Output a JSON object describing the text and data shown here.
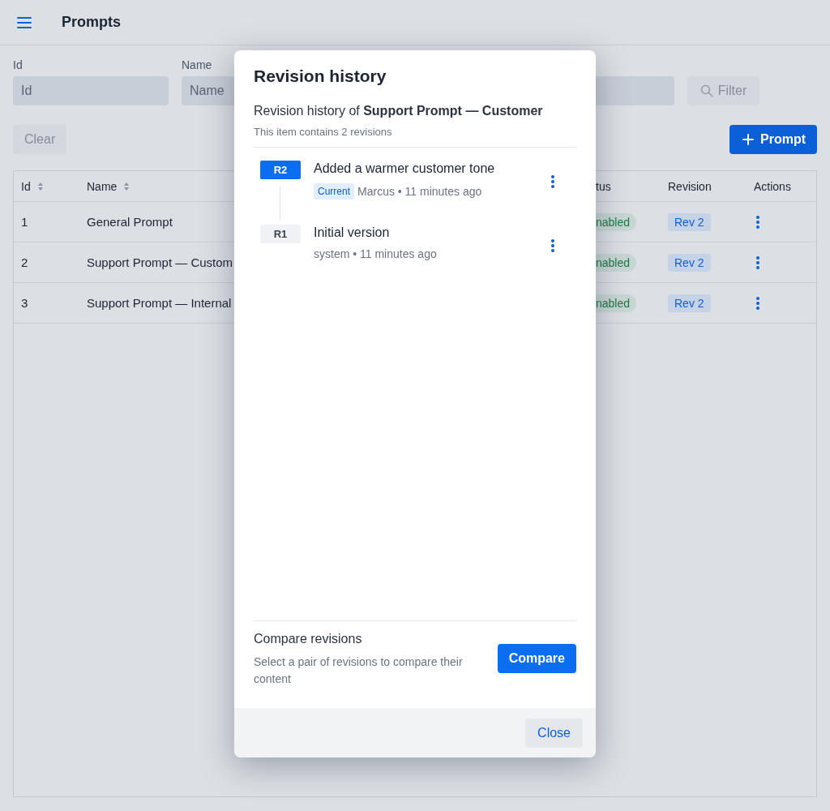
{
  "header": {
    "title": "Prompts"
  },
  "filters": {
    "fields": [
      {
        "label": "Id",
        "placeholder": "Id"
      },
      {
        "label": "Name",
        "placeholder": "Name"
      }
    ],
    "filter_button": {
      "label": "Filter",
      "disabled": true
    },
    "clear_button": {
      "label": "Clear",
      "disabled": true
    },
    "new_button": "Prompt"
  },
  "table": {
    "columns": [
      {
        "label": "Id",
        "sortable": true
      },
      {
        "label": "Name",
        "sortable": true
      },
      {
        "label": "tus",
        "sortable": false
      },
      {
        "label": "Revision",
        "sortable": false
      },
      {
        "label": "Actions",
        "sortable": false
      }
    ],
    "rows": [
      {
        "id": "1",
        "name": "General Prompt",
        "status": "nabled",
        "revision": "Rev 2"
      },
      {
        "id": "2",
        "name": "Support Prompt — Custom",
        "status": "nabled",
        "revision": "Rev 2"
      },
      {
        "id": "3",
        "name": "Support Prompt — Internal",
        "status": "nabled",
        "revision": "Rev 2"
      }
    ]
  },
  "modal": {
    "title": "Revision history",
    "subtitle": "Revision history of **Support Prompt — Customer**",
    "count": "This item contains 2 revisions",
    "revisions": [
      {
        "badge": "R2",
        "current": true,
        "current_label": "Current",
        "title": "Added a warmer customer tone",
        "meta": "Marcus • 11 minutes ago"
      },
      {
        "badge": "R1",
        "current": false,
        "title": "Initial version",
        "meta": "system • 11 minutes ago"
      }
    ],
    "compare": {
      "title": "Compare revisions",
      "description": "Select a pair of revisions to compare their content",
      "button": "Compare"
    },
    "close_button": "Close"
  }
}
